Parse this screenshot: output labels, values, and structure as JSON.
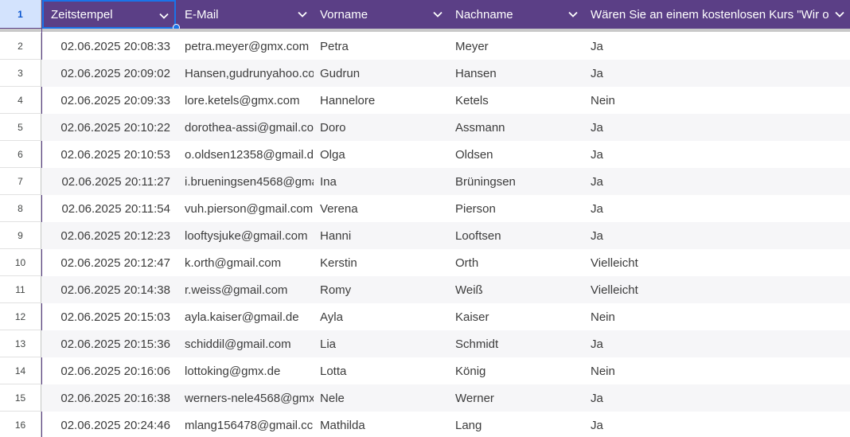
{
  "header": {
    "row_number": "1",
    "columns": [
      {
        "label": "Zeitstempel"
      },
      {
        "label": "E-Mail"
      },
      {
        "label": "Vorname"
      },
      {
        "label": "Nachname"
      },
      {
        "label": "Wären Sie an einem kostenlosen Kurs \"Wir or"
      }
    ]
  },
  "rows": [
    {
      "num": "2",
      "ts": "02.06.2025 20:08:33",
      "email": "petra.meyer@gmx.com",
      "vorname": "Petra",
      "nachname": "Meyer",
      "answer": "Ja"
    },
    {
      "num": "3",
      "ts": "02.06.2025 20:09:02",
      "email": "Hansen,gudrunyahoo.co",
      "vorname": "Gudrun",
      "nachname": "Hansen",
      "answer": "Ja"
    },
    {
      "num": "4",
      "ts": "02.06.2025 20:09:33",
      "email": "lore.ketels@gmx.com",
      "vorname": "Hannelore",
      "nachname": "Ketels",
      "answer": "Nein"
    },
    {
      "num": "5",
      "ts": "02.06.2025 20:10:22",
      "email": "dorothea-assi@gmail.co",
      "vorname": "Doro",
      "nachname": "Assmann",
      "answer": "Ja"
    },
    {
      "num": "6",
      "ts": "02.06.2025 20:10:53",
      "email": "o.oldsen12358@gmail.d",
      "vorname": "Olga",
      "nachname": "Oldsen",
      "answer": "Ja"
    },
    {
      "num": "7",
      "ts": "02.06.2025 20:11:27",
      "email": "i.brueningsen4568@gma",
      "vorname": "Ina",
      "nachname": "Brüningsen",
      "answer": "Ja"
    },
    {
      "num": "8",
      "ts": "02.06.2025 20:11:54",
      "email": "vuh.pierson@gmail.com",
      "vorname": "Verena",
      "nachname": "Pierson",
      "answer": "Ja"
    },
    {
      "num": "9",
      "ts": "02.06.2025 20:12:23",
      "email": "looftysjuke@gmail.com",
      "vorname": "Hanni",
      "nachname": "Looftsen",
      "answer": "Ja"
    },
    {
      "num": "10",
      "ts": "02.06.2025 20:12:47",
      "email": "k.orth@gmail.com",
      "vorname": "Kerstin",
      "nachname": "Orth",
      "answer": "Vielleicht"
    },
    {
      "num": "11",
      "ts": "02.06.2025 20:14:38",
      "email": "r.weiss@gmail.com",
      "vorname": "Romy",
      "nachname": "Weiß",
      "answer": "Vielleicht"
    },
    {
      "num": "12",
      "ts": "02.06.2025 20:15:03",
      "email": "ayla.kaiser@gmail.de",
      "vorname": "Ayla",
      "nachname": "Kaiser",
      "answer": "Nein"
    },
    {
      "num": "13",
      "ts": "02.06.2025 20:15:36",
      "email": "schiddil@gmail.com",
      "vorname": "Lia",
      "nachname": "Schmidt",
      "answer": "Ja"
    },
    {
      "num": "14",
      "ts": "02.06.2025 20:16:06",
      "email": "lottoking@gmx.de",
      "vorname": "Lotta",
      "nachname": "König",
      "answer": "Nein"
    },
    {
      "num": "15",
      "ts": "02.06.2025 20:16:38",
      "email": "werners-nele4568@gmx",
      "vorname": "Nele",
      "nachname": "Werner",
      "answer": "Ja"
    },
    {
      "num": "16",
      "ts": "02.06.2025 20:24:46",
      "email": "mlang156478@gmail.cc",
      "vorname": "Mathilda",
      "nachname": "Lang",
      "answer": "Ja"
    }
  ],
  "colors": {
    "header_bg": "#5b3f86",
    "selection": "#1a73e8",
    "row_alt": "#f6f6f8"
  },
  "icons": {
    "column_menu": "chevron-down-icon",
    "selection_handle": "fill-handle"
  }
}
